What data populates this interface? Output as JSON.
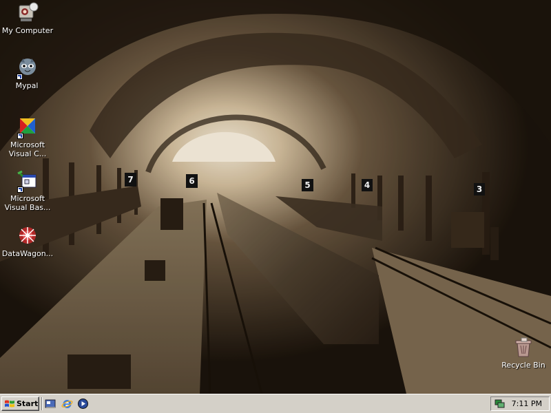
{
  "desktop": {
    "icons": [
      {
        "label": "My Computer",
        "icon": "my-computer-icon"
      },
      {
        "label": "Mypal",
        "icon": "mypal-browser-icon"
      },
      {
        "label": "Microsoft Visual C...",
        "line1": "Microsoft",
        "line2": "Visual C...",
        "icon": "visual-c-icon"
      },
      {
        "label": "Microsoft Visual Bas...",
        "line1": "Microsoft",
        "line2": "Visual Bas...",
        "icon": "visual-basic-icon"
      },
      {
        "label": "DataWagon...",
        "icon": "datawagon-icon"
      },
      {
        "label": "Recycle Bin",
        "icon": "recycle-bin-icon"
      }
    ],
    "wallpaper": {
      "subject": "sepia photograph of train station platforms",
      "platform_signs": [
        "7",
        "6",
        "5",
        "4",
        "3"
      ],
      "colors": {
        "dark": "#1a120a",
        "mid": "#6b5a44",
        "light": "#f4e7cf"
      }
    }
  },
  "taskbar": {
    "start_label": "Start",
    "quick_launch": [
      "show-desktop-icon",
      "internet-explorer-icon",
      "media-player-icon"
    ],
    "tray": {
      "clock": "7:11 PM",
      "icon": "network-icon"
    }
  }
}
